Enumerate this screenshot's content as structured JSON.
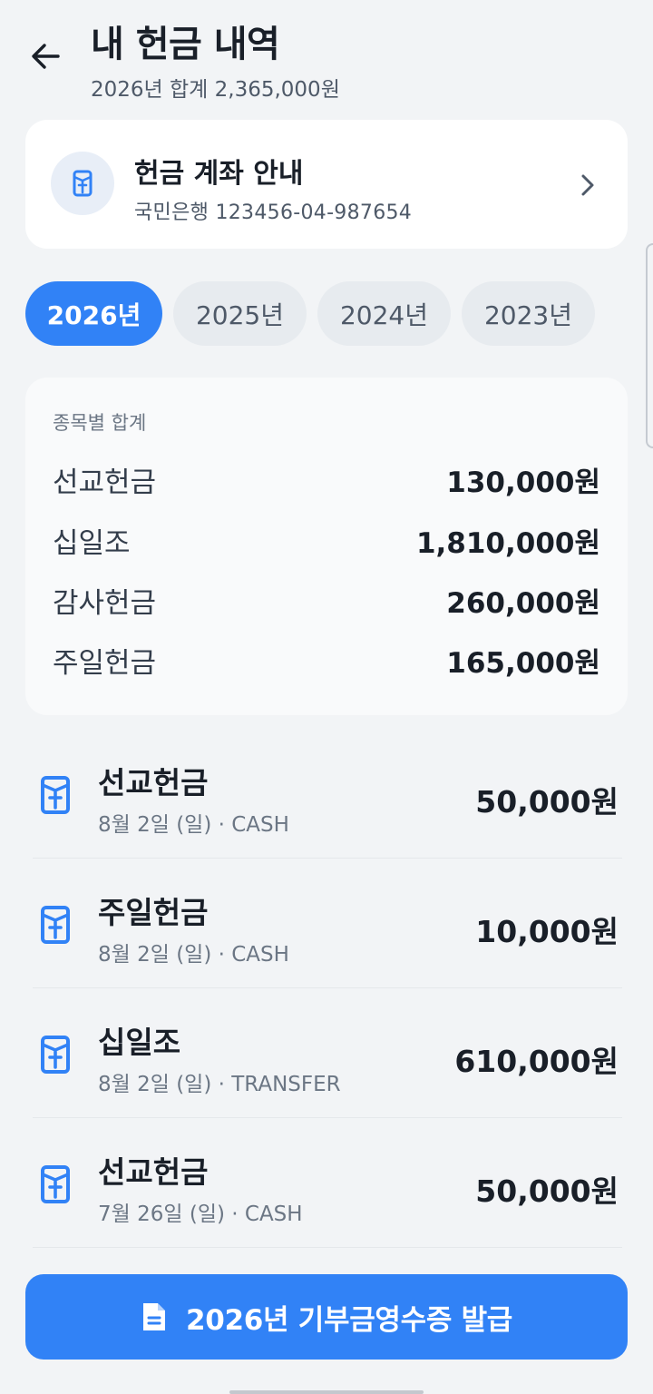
{
  "header": {
    "title": "내 헌금 내역",
    "subtitle": "2026년 합계 2,365,000원"
  },
  "account": {
    "title": "헌금 계좌 안내",
    "detail": "국민은행 123456-04-987654"
  },
  "years": [
    {
      "label": "2026년",
      "active": true
    },
    {
      "label": "2025년",
      "active": false
    },
    {
      "label": "2024년",
      "active": false
    },
    {
      "label": "2023년",
      "active": false
    }
  ],
  "summary": {
    "label": "종목별 합계",
    "rows": [
      {
        "name": "선교헌금",
        "amount": "130,000원"
      },
      {
        "name": "십일조",
        "amount": "1,810,000원"
      },
      {
        "name": "감사헌금",
        "amount": "260,000원"
      },
      {
        "name": "주일헌금",
        "amount": "165,000원"
      }
    ]
  },
  "records": [
    {
      "name": "선교헌금",
      "meta": "8월 2일 (일) · CASH",
      "amount": "50,000원"
    },
    {
      "name": "주일헌금",
      "meta": "8월 2일 (일) · CASH",
      "amount": "10,000원"
    },
    {
      "name": "십일조",
      "meta": "8월 2일 (일) · TRANSFER",
      "amount": "610,000원"
    },
    {
      "name": "선교헌금",
      "meta": "7월 26일 (일) · CASH",
      "amount": "50,000원"
    }
  ],
  "issue_button": {
    "label": "2026년 기부금영수증 발급"
  },
  "icons": {
    "back": "arrow-left-icon",
    "offering": "offering-envelope-icon",
    "chevron": "chevron-right-icon",
    "document": "document-icon"
  },
  "colors": {
    "accent": "#3182f6",
    "background": "#f2f4f6",
    "card": "#ffffff"
  }
}
